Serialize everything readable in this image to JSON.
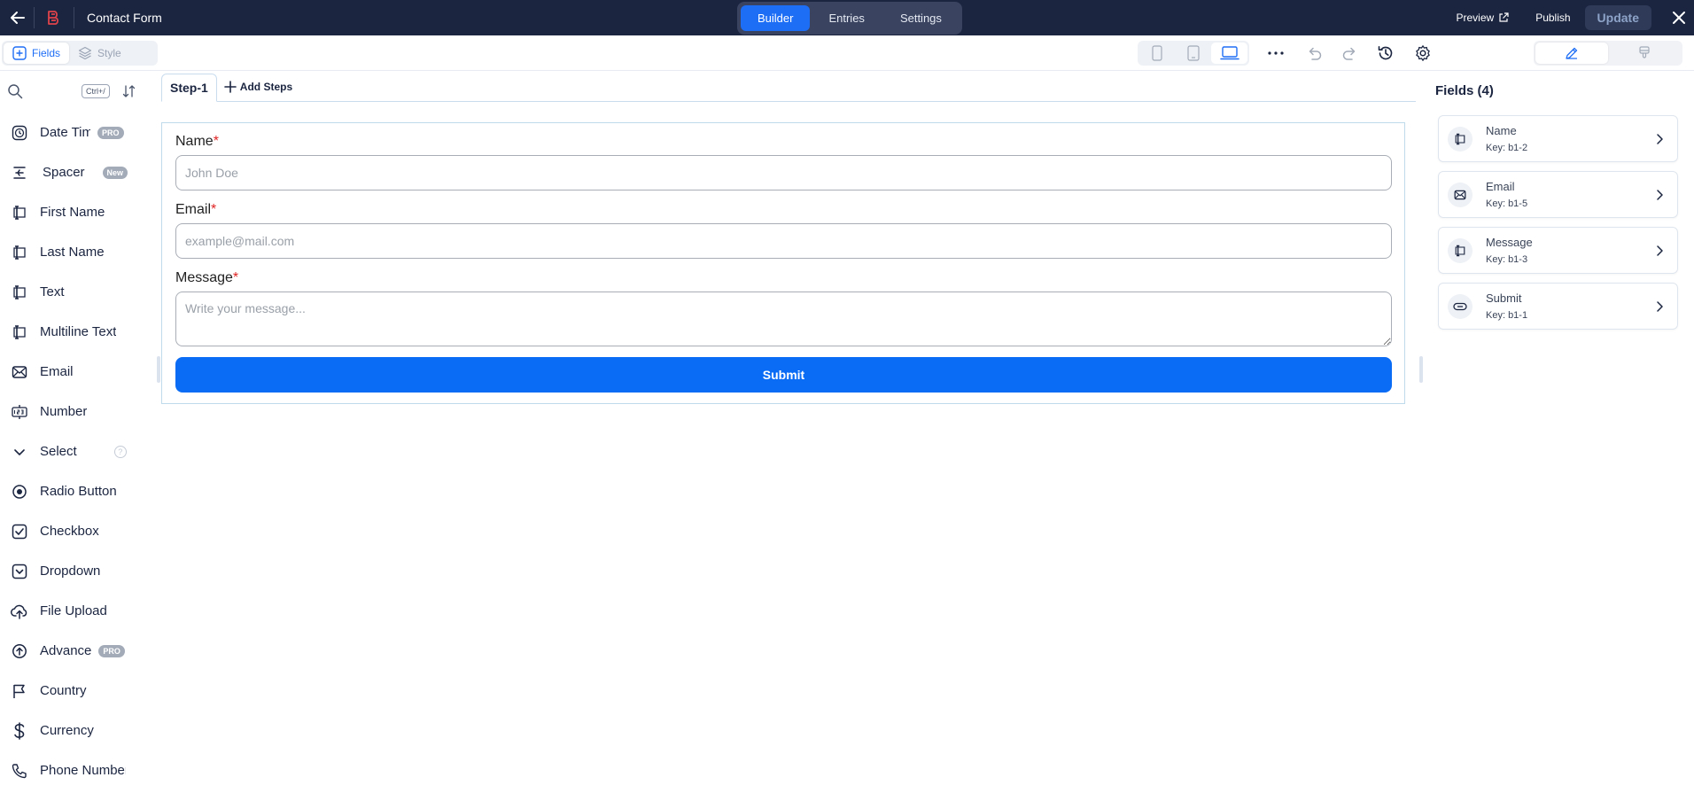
{
  "topbar": {
    "title": "Contact Form",
    "tabs": [
      {
        "label": "Builder",
        "active": true
      },
      {
        "label": "Entries",
        "active": false
      },
      {
        "label": "Settings",
        "active": false
      }
    ],
    "preview_label": "Preview",
    "publish_label": "Publish",
    "update_label": "Update"
  },
  "toolbar": {
    "fields_label": "Fields",
    "style_label": "Style",
    "active_device": "laptop"
  },
  "sidebar": {
    "search": {
      "placeholder": "",
      "shortcut": "Ctrl+/"
    },
    "items": [
      {
        "label": "Date Time",
        "icon": "clock-icon",
        "badge": "PRO"
      },
      {
        "label": "Spacer",
        "icon": "spacer-icon",
        "badge": "New"
      },
      {
        "label": "First Name",
        "icon": "text-cursor-icon"
      },
      {
        "label": "Last Name",
        "icon": "text-cursor-icon"
      },
      {
        "label": "Text",
        "icon": "text-cursor-icon"
      },
      {
        "label": "Multiline Text",
        "icon": "text-cursor-icon"
      },
      {
        "label": "Email",
        "icon": "mail-icon"
      },
      {
        "label": "Number",
        "icon": "number-icon"
      },
      {
        "label": "Select",
        "icon": "chevron-down-icon",
        "help": "?"
      },
      {
        "label": "Radio Button",
        "icon": "radio-icon"
      },
      {
        "label": "Checkbox",
        "icon": "checkbox-icon"
      },
      {
        "label": "Dropdown",
        "icon": "dropdown-icon"
      },
      {
        "label": "File Upload",
        "icon": "cloud-upload-icon"
      },
      {
        "label": "Advance",
        "icon": "upload-circle-icon",
        "badge": "PRO"
      },
      {
        "label": "Country",
        "icon": "flag-icon"
      },
      {
        "label": "Currency",
        "icon": "dollar-icon"
      },
      {
        "label": "Phone Number",
        "icon": "phone-icon"
      }
    ]
  },
  "canvas": {
    "steps": [
      {
        "label": "Step-1"
      }
    ],
    "add_steps_label": "Add Steps",
    "form": {
      "name": {
        "label": "Name",
        "required": "*",
        "placeholder": "John Doe"
      },
      "email": {
        "label": "Email",
        "required": "*",
        "placeholder": "example@mail.com"
      },
      "message": {
        "label": "Message",
        "required": "*",
        "placeholder": "Write your message..."
      },
      "submit_label": "Submit"
    }
  },
  "right_panel": {
    "title": "Fields (4)",
    "fields": [
      {
        "name": "Name",
        "key": "Key: b1-2",
        "icon": "text-cursor-icon"
      },
      {
        "name": "Email",
        "key": "Key: b1-5",
        "icon": "mail-icon"
      },
      {
        "name": "Message",
        "key": "Key: b1-3",
        "icon": "text-cursor-icon"
      },
      {
        "name": "Submit",
        "key": "Key: b1-1",
        "icon": "button-icon"
      }
    ]
  },
  "colors": {
    "topbar_bg": "#1b2540",
    "accent": "#1e6ef5",
    "submit_bg": "#0a6cf5",
    "required": "#e02424",
    "logo": "#e0434a"
  }
}
